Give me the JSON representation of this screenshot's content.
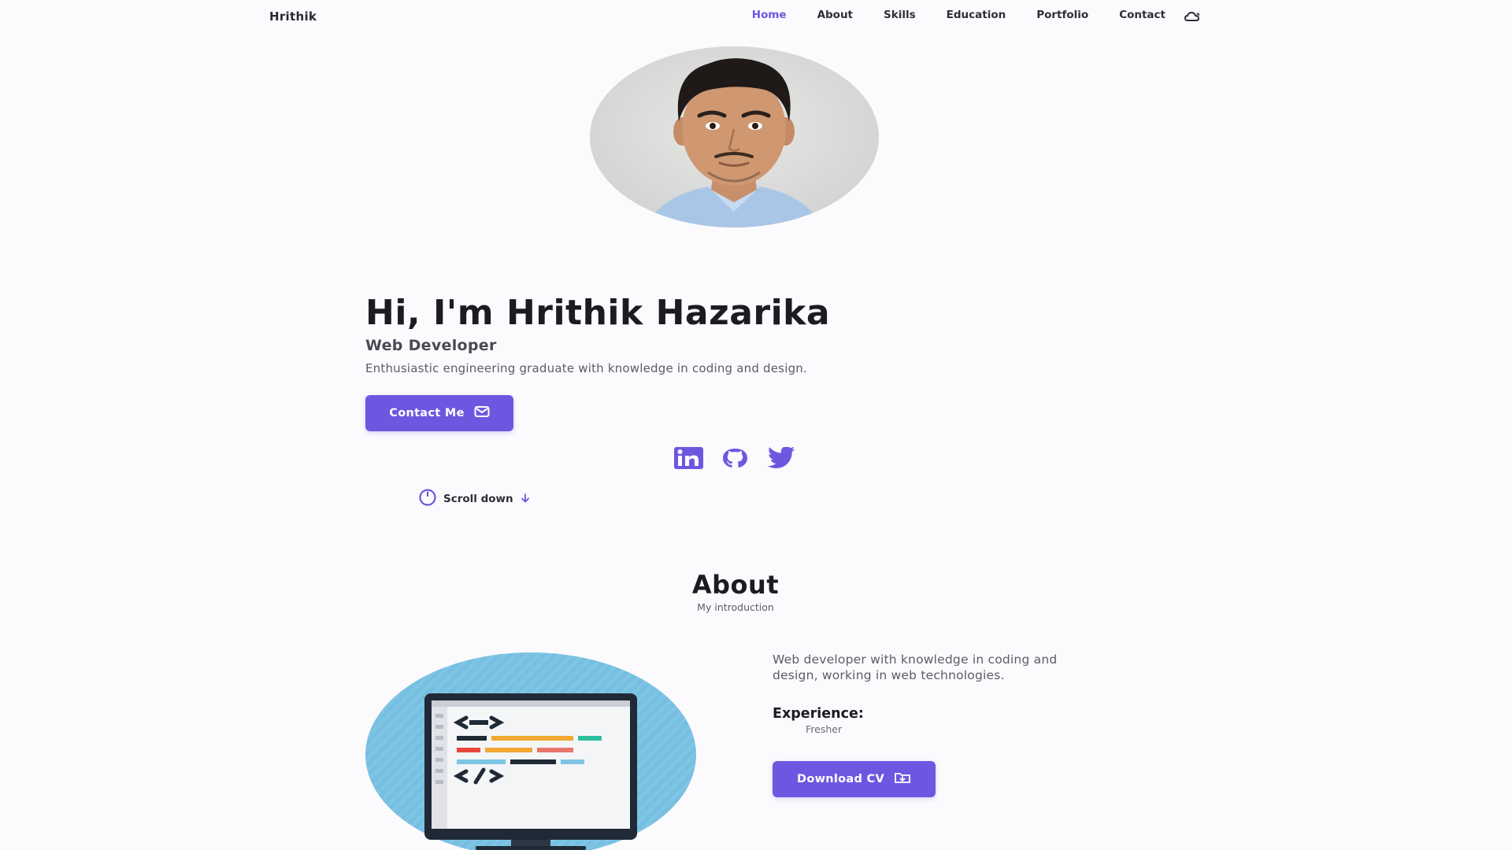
{
  "brand": {
    "logo": "Hrithik",
    "accent": "#6e57e0"
  },
  "nav": {
    "items": [
      {
        "label": "Home",
        "active": true
      },
      {
        "label": "About",
        "active": false
      },
      {
        "label": "Skills",
        "active": false
      },
      {
        "label": "Education",
        "active": false
      },
      {
        "label": "Portfolio",
        "active": false
      },
      {
        "label": "Contact",
        "active": false
      }
    ],
    "theme_toggle_icon": "moon-cloud-icon"
  },
  "hero": {
    "avatar_icon": "profile-photo",
    "title": "Hi, I'm Hrithik Hazarika",
    "subtitle": "Web Developer",
    "description": "Enthusiastic engineering graduate with knowledge in coding and design.",
    "contact_button": "Contact Me",
    "contact_button_icon": "mail-icon",
    "socials": [
      {
        "icon": "linkedin-icon"
      },
      {
        "icon": "github-icon"
      },
      {
        "icon": "twitter-icon"
      }
    ],
    "scroll": {
      "label": "Scroll down",
      "icon": "mouse-icon",
      "arrow_icon": "arrow-down-icon"
    }
  },
  "about": {
    "title": "About",
    "subtitle": "My introduction",
    "image_icon": "code-monitor-illustration",
    "description": "Web developer with knowledge in coding and design, working in web technologies.",
    "experience_label": "Experience:",
    "experience_value": "Fresher",
    "download_button": "Download CV",
    "download_icon": "download-icon"
  }
}
